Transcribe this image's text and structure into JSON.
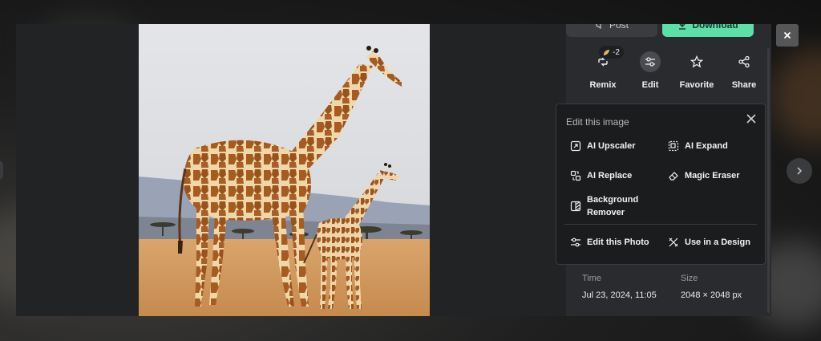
{
  "modal": {
    "post_label": "Post",
    "download_label": "Download",
    "credit_badge": "-2",
    "actions": [
      {
        "label": "Remix",
        "icon": "remix-icon"
      },
      {
        "label": "Edit",
        "icon": "sliders-icon"
      },
      {
        "label": "Favorite",
        "icon": "star-icon"
      },
      {
        "label": "Share",
        "icon": "share-icon"
      }
    ]
  },
  "edit_panel": {
    "title": "Edit this image",
    "tools": [
      {
        "label": "AI Upscaler",
        "icon": "upscale-icon"
      },
      {
        "label": "AI Expand",
        "icon": "expand-icon"
      },
      {
        "label": "AI Replace",
        "icon": "replace-icon"
      },
      {
        "label": "Magic Eraser",
        "icon": "eraser-icon"
      },
      {
        "label": "Background Remover",
        "icon": "background-remover-icon"
      },
      {
        "label": "Edit this Photo",
        "icon": "sliders-icon"
      },
      {
        "label": "Use in a Design",
        "icon": "design-icon"
      }
    ]
  },
  "details": {
    "time_label": "Time",
    "time_value": "Jul 23, 2024, 11:05",
    "size_label": "Size",
    "size_value": "2048 × 2048 px"
  },
  "colors": {
    "accent": "#5ce0a8",
    "panel_bg": "#2a2b2e",
    "card_bg": "#1b1c1e"
  }
}
